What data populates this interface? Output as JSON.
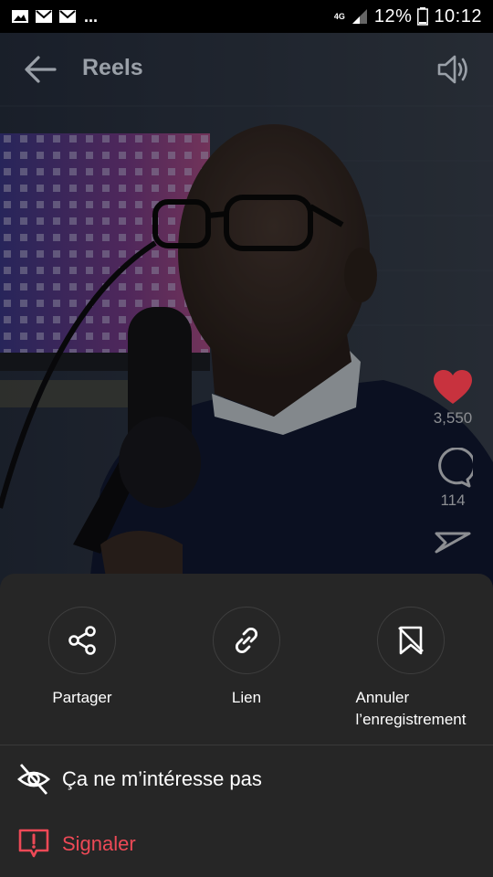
{
  "status_bar": {
    "network": "4G",
    "battery": "12%",
    "time": "10:12",
    "dots": "..."
  },
  "header": {
    "title": "Reels"
  },
  "side_actions": {
    "likes": "3,550",
    "comments": "114"
  },
  "sheet": {
    "actions": [
      {
        "label": "Partager",
        "icon": "share-icon"
      },
      {
        "label": "Lien",
        "icon": "link-icon"
      },
      {
        "label_line1": "Annuler",
        "label_line2": "l’enregistrement",
        "icon": "unsave-icon"
      }
    ],
    "menu": [
      {
        "label": "Ça ne m’intéresse pas",
        "icon": "eye-off-icon"
      },
      {
        "label": "Signaler",
        "icon": "report-icon"
      }
    ]
  },
  "colors": {
    "sheet_bg": "#262626",
    "danger": "#ed4956",
    "heart": "#c8323e"
  }
}
